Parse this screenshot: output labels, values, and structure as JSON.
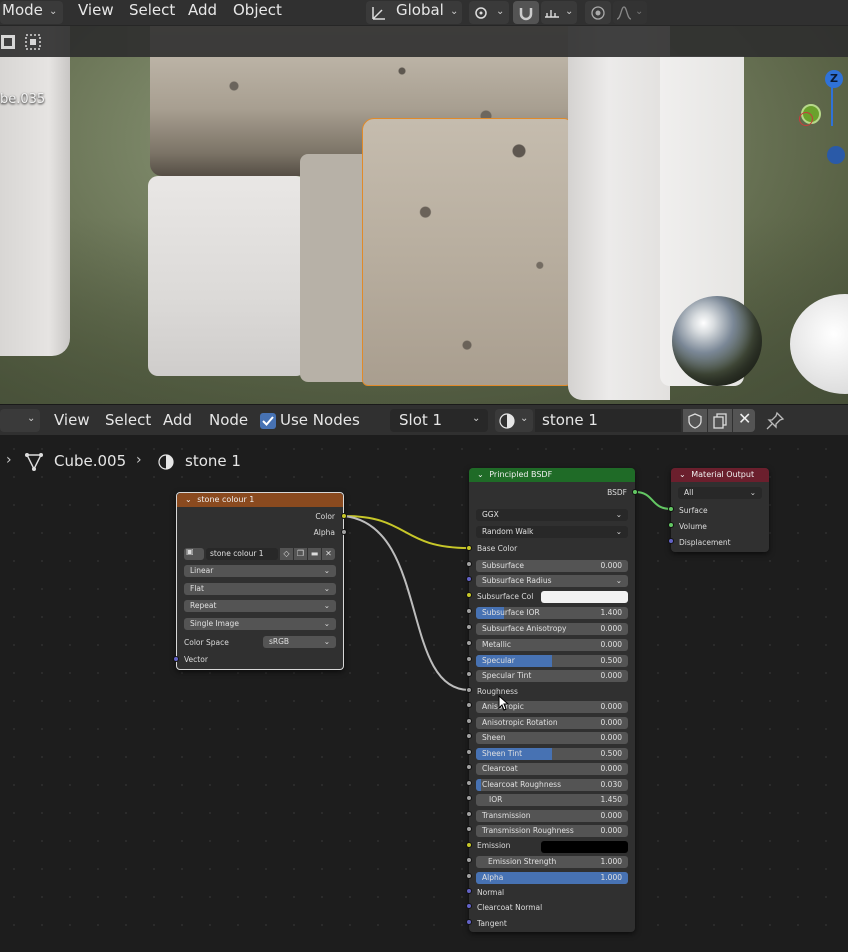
{
  "viewport_header": {
    "mode_label": "Mode",
    "menu": [
      "View",
      "Select",
      "Add",
      "Object"
    ],
    "transform_orientation": "Global"
  },
  "viewport": {
    "object_label": "be.035",
    "gizmo_z": "Z"
  },
  "node_editor_header": {
    "menu": [
      "View",
      "Select",
      "Add",
      "Node"
    ],
    "use_nodes_label": "Use Nodes",
    "slot_label": "Slot 1",
    "material_name": "stone 1"
  },
  "breadcrumb": {
    "object": "Cube.005",
    "material": "stone 1"
  },
  "image_node": {
    "title": "stone colour 1",
    "outputs": [
      "Color",
      "Alpha"
    ],
    "image_name": "stone colour 1",
    "interpolation": "Linear",
    "projection": "Flat",
    "extension": "Repeat",
    "source": "Single Image",
    "color_space_label": "Color Space",
    "color_space": "sRGB",
    "input": "Vector"
  },
  "bsdf_node": {
    "title": "Principled BSDF",
    "output": "BSDF",
    "distribution": "GGX",
    "subsurface_method": "Random Walk",
    "base_color_label": "Base Color",
    "subsurface_label": "Subsurface",
    "subsurface_value": "0.000",
    "subsurface_radius_label": "Subsurface Radius",
    "subsurface_color_label": "Subsurface Col",
    "subsurface_ior_label": "Subsurface IOR",
    "subsurface_ior_value": "1.400",
    "subsurface_anisotropy_label": "Subsurface Anisotropy",
    "subsurface_anisotropy_value": "0.000",
    "metallic_label": "Metallic",
    "metallic_value": "0.000",
    "specular_label": "Specular",
    "specular_value": "0.500",
    "specular_tint_label": "Specular Tint",
    "specular_tint_value": "0.000",
    "roughness_label": "Roughness",
    "anisotropic_label": "Anisotropic",
    "anisotropic_value": "0.000",
    "anisotropic_rotation_label": "Anisotropic Rotation",
    "anisotropic_rotation_value": "0.000",
    "sheen_label": "Sheen",
    "sheen_value": "0.000",
    "sheen_tint_label": "Sheen Tint",
    "sheen_tint_value": "0.500",
    "clearcoat_label": "Clearcoat",
    "clearcoat_value": "0.000",
    "clearcoat_roughness_label": "Clearcoat Roughness",
    "clearcoat_roughness_value": "0.030",
    "ior_label": "IOR",
    "ior_value": "1.450",
    "transmission_label": "Transmission",
    "transmission_value": "0.000",
    "transmission_roughness_label": "Transmission Roughness",
    "transmission_roughness_value": "0.000",
    "emission_label": "Emission",
    "emission_strength_label": "Emission Strength",
    "emission_strength_value": "1.000",
    "alpha_label": "Alpha",
    "alpha_value": "1.000",
    "normal_label": "Normal",
    "clearcoat_normal_label": "Clearcoat Normal",
    "tangent_label": "Tangent"
  },
  "output_node": {
    "title": "Material Output",
    "target": "All",
    "inputs": [
      "Surface",
      "Volume",
      "Displacement"
    ]
  },
  "colors": {
    "image_header": "#8a4a1f",
    "bsdf_header": "#1f6b27",
    "output_header": "#6b1f2d",
    "slider_fill": "#4772b3",
    "checkbox": "#4772b3"
  }
}
